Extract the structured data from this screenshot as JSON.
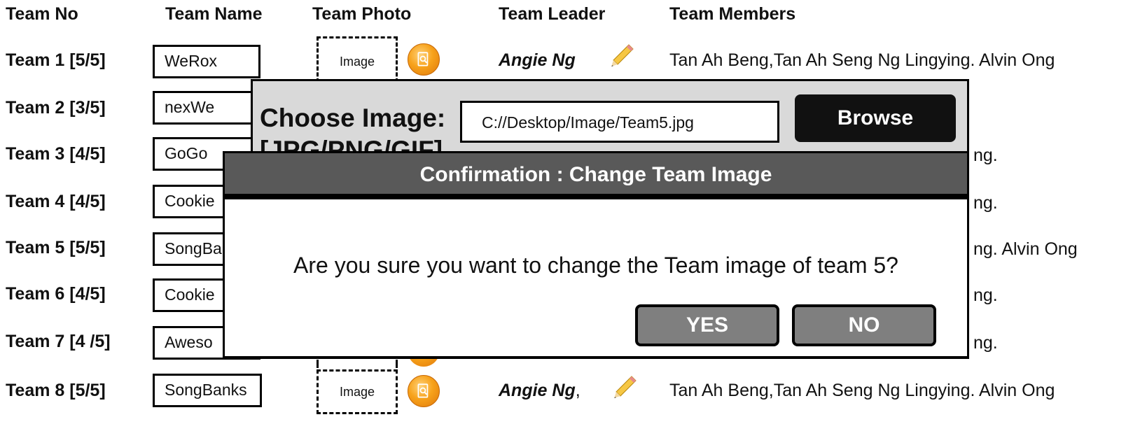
{
  "headers": {
    "team_no": "Team No",
    "team_name": "Team Name",
    "team_photo": "Team Photo",
    "team_leader": "Team Leader",
    "team_members": "Team Members"
  },
  "rows": [
    {
      "team_no": "Team 1 [5/5]",
      "team_name": "WeRox",
      "photo_label": "Image",
      "leader": "Angie Ng",
      "leader_suffix": "",
      "members": "Tan Ah Beng,Tan Ah Seng Ng Lingying. Alvin Ong"
    },
    {
      "team_no": "Team 2 [3/5]",
      "team_name": "nexWe"
    },
    {
      "team_no": "Team 3 [4/5]",
      "team_name": "GoGo",
      "members_tail": "ng."
    },
    {
      "team_no": "Team 4 [4/5]",
      "team_name": "Cookie",
      "members_tail": "ng."
    },
    {
      "team_no": "Team 5 [5/5]",
      "team_name": "SongBa",
      "members_tail": "ng. Alvin Ong"
    },
    {
      "team_no": "Team 6 [4/5]",
      "team_name": "Cookie",
      "members_tail": "ng."
    },
    {
      "team_no": "Team 7 [4 /5]",
      "team_name": "Aweso",
      "members_tail": "ng."
    },
    {
      "team_no": "Team 8 [5/5]",
      "team_name": "SongBanks",
      "photo_label": "Image",
      "leader": "Angie Ng",
      "leader_suffix": ",",
      "members": "Tan Ah Beng,Tan Ah Seng Ng Lingying. Alvin Ong"
    }
  ],
  "chooser": {
    "label": "Choose Image: [JPG/PNG/GIF]",
    "path_value": "C://Desktop/Image/Team5.jpg",
    "browse_label": "Browse"
  },
  "confirm": {
    "title": "Confirmation : Change Team Image",
    "message": "Are you sure you want to change the Team image of team 5?",
    "yes_label": "YES",
    "no_label": "NO"
  },
  "icons": {
    "upload": "upload-image-icon",
    "edit": "pencil-icon"
  },
  "colors": {
    "dialog_title_bg": "#595959",
    "chooser_bg": "#d9d9d9",
    "button_gray": "#7f7f7f",
    "browse_bg": "#111111",
    "icon_orange": "#f7a21b"
  }
}
